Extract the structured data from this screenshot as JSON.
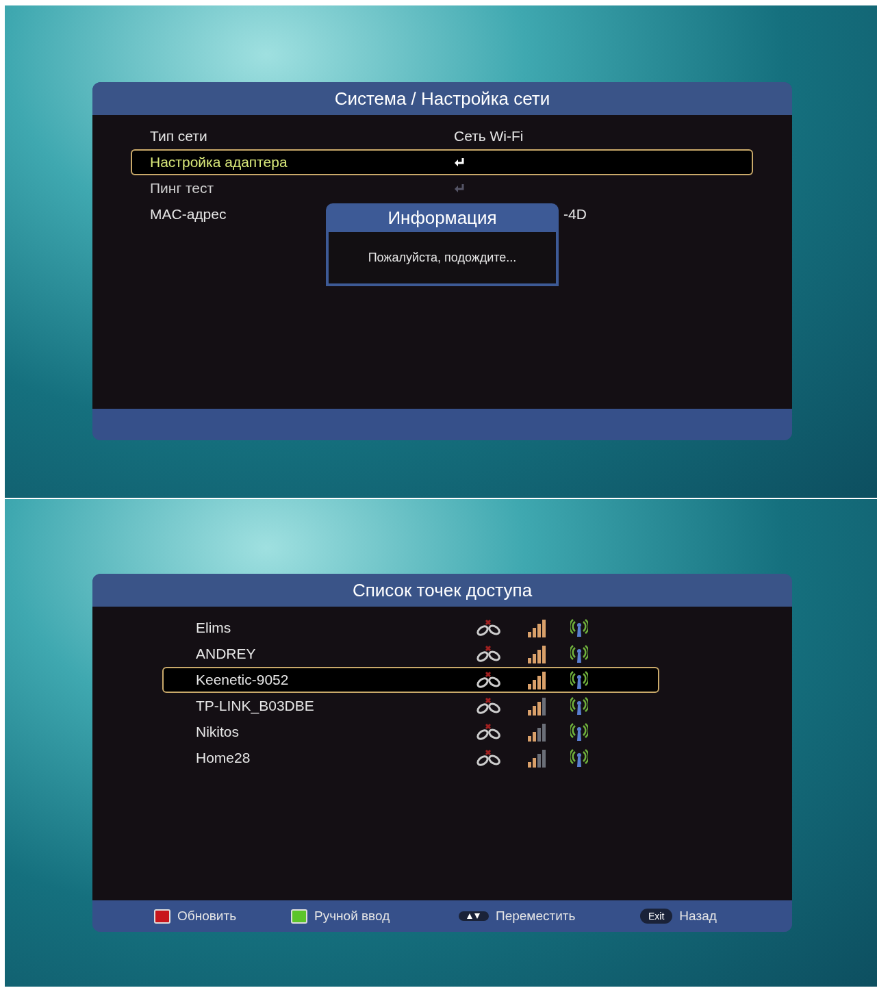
{
  "screens": [
    {
      "kind": "settings",
      "title": "Система / Настройка сети",
      "rows": [
        {
          "label": "Тип сети",
          "kind": "value",
          "value": "Сеть Wi-Fi",
          "selected": false
        },
        {
          "label": "Настройка адаптера",
          "kind": "enter",
          "selected": true,
          "disabled": false
        },
        {
          "label": "Пинг тест",
          "kind": "enter",
          "selected": false,
          "disabled": true
        },
        {
          "label": "MAC-адрес",
          "kind": "covered",
          "value": "-4D",
          "selected": false
        }
      ],
      "dialog": {
        "title": "Информация",
        "message": "Пожалуйста, подождите..."
      }
    },
    {
      "kind": "access_points",
      "title": "Список точек доступа",
      "networks": [
        {
          "name": "Elims",
          "level": 1,
          "selected": false
        },
        {
          "name": "ANDREY",
          "level": 1,
          "selected": false
        },
        {
          "name": "Keenetic-9052",
          "level": 1,
          "selected": true
        },
        {
          "name": "TP-LINK_B03DBE",
          "level": 0.75,
          "selected": false
        },
        {
          "name": "Nikitos",
          "level": 0.5,
          "selected": false
        },
        {
          "name": "Home28",
          "level": 0.5,
          "selected": false
        }
      ],
      "footer": [
        {
          "kind": "color",
          "color": "#c8161c",
          "label": "Обновить"
        },
        {
          "kind": "color",
          "color": "#5cc52a",
          "label": "Ручной ввод"
        },
        {
          "kind": "arrows",
          "label": "Переместить"
        },
        {
          "kind": "key",
          "key": "Exit",
          "label": "Назад"
        }
      ]
    }
  ]
}
